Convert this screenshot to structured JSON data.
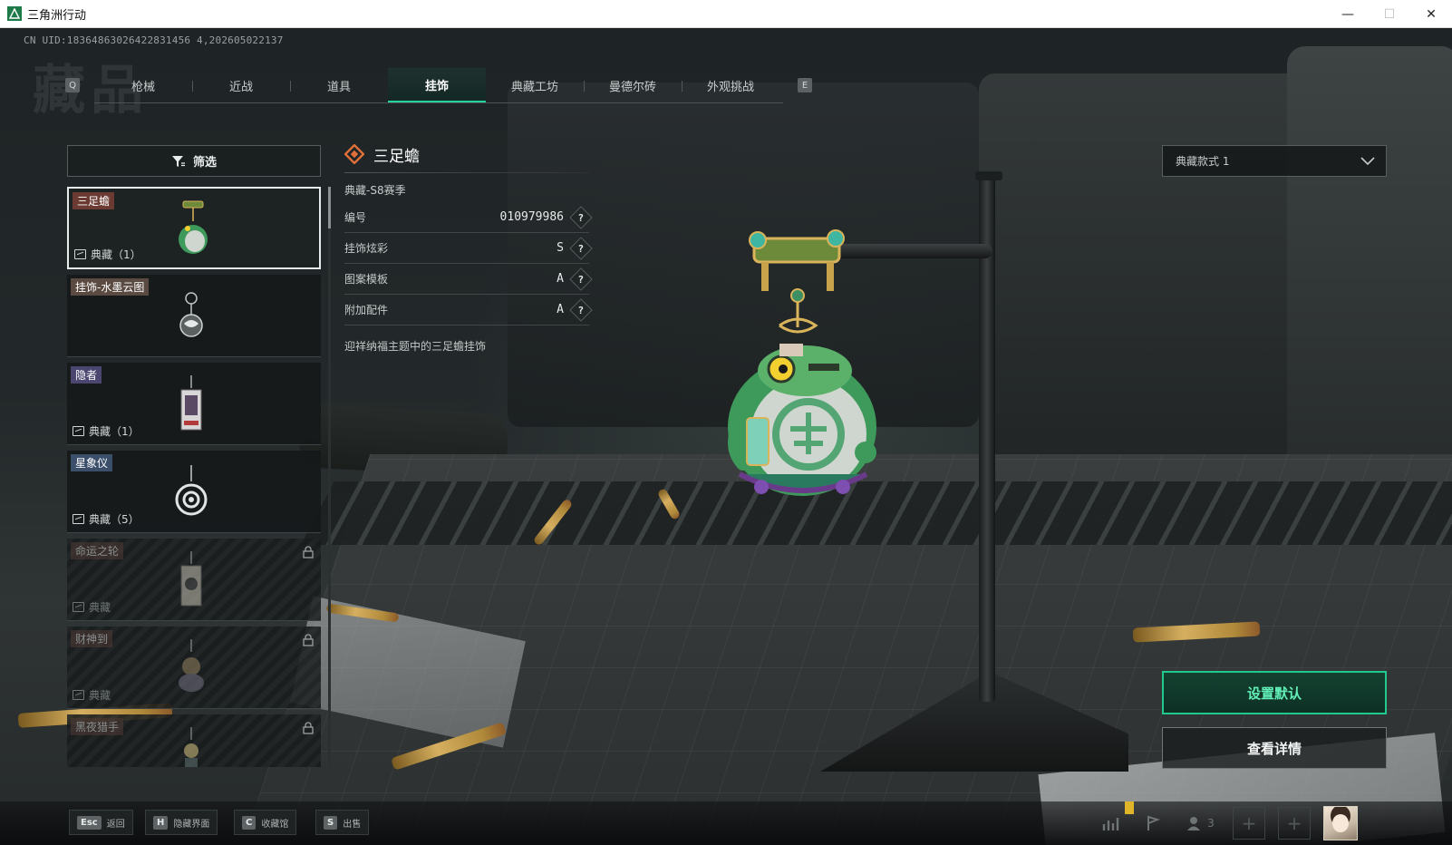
{
  "window": {
    "title": "三角洲行动",
    "controls": {
      "minimize": "—",
      "maximize": "☐",
      "close": "✕"
    }
  },
  "header": {
    "uid_text": "CN UID:18364863026422831456 4,202605022137",
    "bg_title": "藏品",
    "prev_key": "Q",
    "next_key": "E"
  },
  "tabs": [
    {
      "label": "枪械",
      "active": false
    },
    {
      "label": "近战",
      "active": false
    },
    {
      "label": "道具",
      "active": false
    },
    {
      "label": "挂饰",
      "active": true
    },
    {
      "label": "典藏工坊",
      "active": false
    },
    {
      "label": "曼德尔砖",
      "active": false
    },
    {
      "label": "外观挑战",
      "active": false
    }
  ],
  "filter": {
    "label": "筛选"
  },
  "items": [
    {
      "tag": "三足蟾",
      "tag_color": "#6b3a33",
      "footer": "典藏（1）",
      "selected": true,
      "locked": false
    },
    {
      "tag": "挂饰-水墨云图",
      "tag_color": "#5a4a41",
      "footer": "",
      "selected": false,
      "locked": false
    },
    {
      "tag": "隐者",
      "tag_color": "#4a4670",
      "footer": "典藏（1）",
      "selected": false,
      "locked": false
    },
    {
      "tag": "星象仪",
      "tag_color": "#3b4f6b",
      "footer": "典藏（5）",
      "selected": false,
      "locked": false
    },
    {
      "tag": "命运之轮",
      "tag_color": "#5a4a41",
      "footer": "典藏",
      "selected": false,
      "locked": true
    },
    {
      "tag": "财神到",
      "tag_color": "#5a4a41",
      "footer": "典藏",
      "selected": false,
      "locked": true
    },
    {
      "tag": "黑夜猎手",
      "tag_color": "#5a4a41",
      "footer": "",
      "selected": false,
      "locked": true
    }
  ],
  "detail": {
    "name": "三足蟾",
    "season": "典藏-S8赛季",
    "rows": [
      {
        "label": "编号",
        "value": "010979986"
      },
      {
        "label": "挂饰炫彩",
        "value": "S"
      },
      {
        "label": "图案模板",
        "value": "A"
      },
      {
        "label": "附加配件",
        "value": "A"
      }
    ],
    "description": "迎祥纳福主题中的三足蟾挂饰",
    "help_glyph": "?"
  },
  "style_select": {
    "value": "典藏款式 1"
  },
  "actions": {
    "set_default": "设置默认",
    "view_details": "查看详情"
  },
  "bottom_hotkeys": [
    {
      "key": "Esc",
      "label": "返回"
    },
    {
      "key": "H",
      "label": "隐藏界面"
    },
    {
      "key": "C",
      "label": "收藏馆"
    },
    {
      "key": "S",
      "label": "出售"
    }
  ],
  "tray": {
    "squad_count": "3",
    "slot_glyph": "+"
  },
  "colors": {
    "accent": "#21c98d",
    "accent_text": "#62f0b8",
    "selected_border": "#e7ebeb",
    "diamond": "#e0703a"
  }
}
